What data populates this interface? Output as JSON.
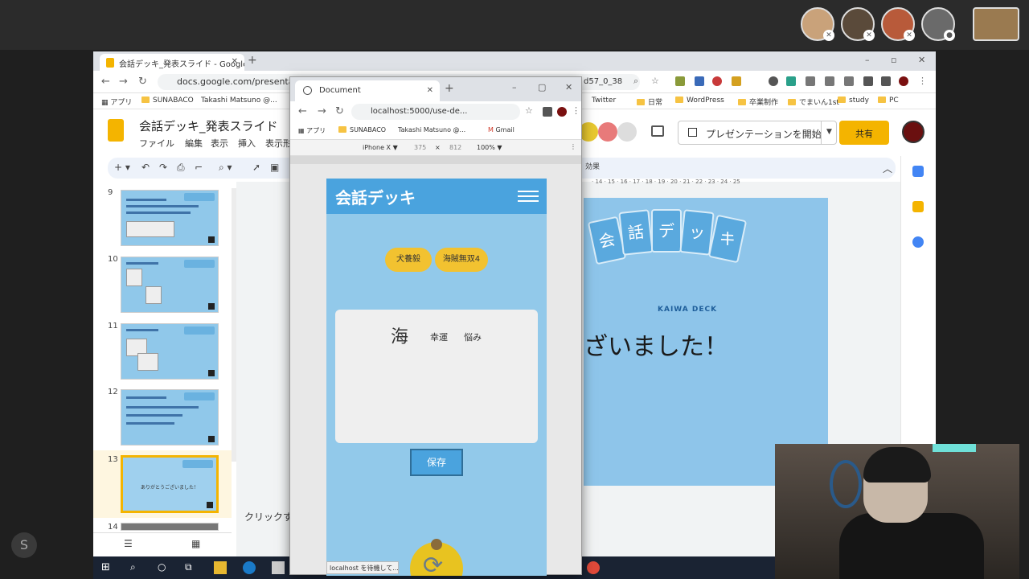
{
  "meeting": {
    "participants": [
      "p1",
      "p2",
      "p3",
      "p4",
      "p5"
    ]
  },
  "browser": {
    "tab_title": "会話デッキ_発表スライド - Google",
    "url": "docs.google.com/presentation/",
    "url_tail": "d57_0_38",
    "bookmarks": [
      "アプリ",
      "SUNABACO",
      "Takashi Matsuno @...",
      "Twitter",
      "日常",
      "WordPress",
      "卒業制作",
      "でまいん1st",
      "study",
      "PC"
    ]
  },
  "docs": {
    "title": "会話デッキ_発表スライド",
    "menu": [
      "ファイル",
      "編集",
      "表示",
      "挿入",
      "表示形"
    ],
    "present_label": "プレゼンテーションを開始",
    "share_label": "共有",
    "effect_label": "効果",
    "notes_placeholder": "クリックす",
    "ruler": "· 14 · 15 · 16 · 17 · 18 · 19 · 20 · 21 · 22 · 23 · 24 · 25"
  },
  "slides": [
    {
      "num": "9"
    },
    {
      "num": "10"
    },
    {
      "num": "11"
    },
    {
      "num": "12"
    },
    {
      "num": "13",
      "text": "ありがとうございました！"
    },
    {
      "num": "14"
    }
  ],
  "current_slide": {
    "text": "ざいました！",
    "logo_chars": [
      "会",
      "話",
      "デ",
      "ッ",
      "キ"
    ],
    "logo_sub": "KAIWA DECK"
  },
  "device_window": {
    "tab_title": "Document",
    "url": "localhost:5000/use-de...",
    "bookmarks": [
      "アプリ",
      "SUNABACO",
      "Takashi Matsuno @...",
      "Gmail"
    ],
    "device": "iPhone X ▼",
    "width": "375",
    "times": "×",
    "height": "812",
    "zoom": "100% ▼",
    "status": "localhost を待機して..."
  },
  "app": {
    "title": "会話デッキ",
    "tags": [
      "犬養毅",
      "海賊無双4"
    ],
    "word_main": "海",
    "word_subs": [
      "幸運",
      "悩み"
    ],
    "save_label": "保存"
  },
  "colors": {
    "app_header": "#4aa3de",
    "app_bg": "#92c9ea",
    "pill": "#f2c230",
    "share": "#f4b400"
  }
}
